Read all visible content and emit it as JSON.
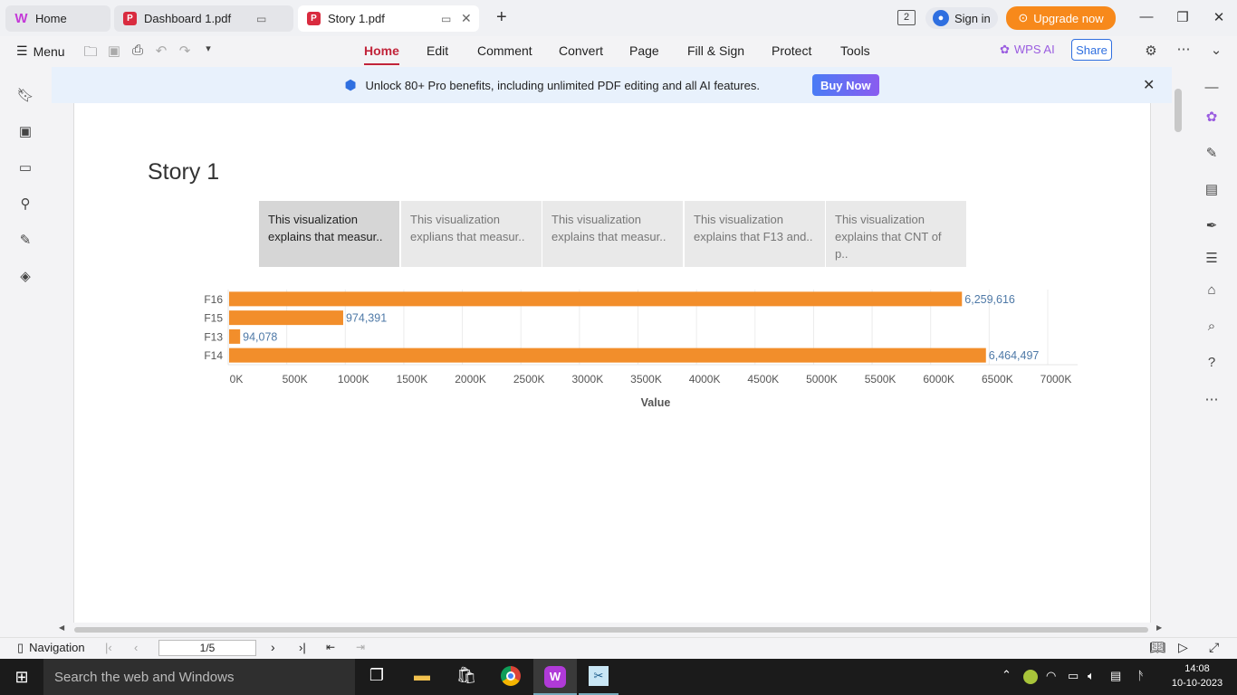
{
  "tabs": [
    {
      "label": "Home",
      "icon": "wps-logo-icon"
    },
    {
      "label": "Dashboard 1.pdf",
      "icon": "pdf-icon"
    },
    {
      "label": "Story 1.pdf",
      "icon": "pdf-icon"
    }
  ],
  "header": {
    "tab_count": "2",
    "sign_in": "Sign in",
    "upgrade": "Upgrade now"
  },
  "menu": {
    "menu_label": "Menu",
    "items": [
      "Home",
      "Edit",
      "Comment",
      "Convert",
      "Page",
      "Fill & Sign",
      "Protect",
      "Tools"
    ],
    "selected": "Home",
    "wps_ai": "WPS AI",
    "share": "Share"
  },
  "banner": {
    "text": "Unlock 80+ Pro benefits, including unlimited PDF editing and all AI features.",
    "button": "Buy Now"
  },
  "document": {
    "title": "Story 1",
    "story_points": [
      {
        "line1": "This visualization",
        "line2": "explains that measur.."
      },
      {
        "line1": "This visualization",
        "line2": "explians that measur.."
      },
      {
        "line1": "This visualization",
        "line2": "explains that measur.."
      },
      {
        "line1": "This visualization",
        "line2": "explains that F13 and.."
      },
      {
        "line1": "This visualization",
        "line2": "explains that CNT of p.."
      }
    ]
  },
  "chart_data": {
    "type": "bar",
    "orientation": "horizontal",
    "categories": [
      "F16",
      "F15",
      "F13",
      "F14"
    ],
    "values": [
      6259616,
      974391,
      94078,
      6464497
    ],
    "value_labels": [
      "6,259,616",
      "974,391",
      "94,078",
      "6,464,497"
    ],
    "xlabel": "Value",
    "xlim": [
      0,
      7000000
    ],
    "tick_labels": [
      "0K",
      "500K",
      "1000K",
      "1500K",
      "2000K",
      "2500K",
      "3000K",
      "3500K",
      "4000K",
      "4500K",
      "5000K",
      "5500K",
      "6000K",
      "6500K",
      "7000K"
    ],
    "bar_color": "#f28e2b",
    "label_color": "#4e79a7",
    "grid": true
  },
  "status": {
    "navigation": "Navigation",
    "page": "1/5"
  },
  "taskbar": {
    "search": "Search the web and Windows",
    "time": "14:08",
    "date": "10-10-2023"
  }
}
